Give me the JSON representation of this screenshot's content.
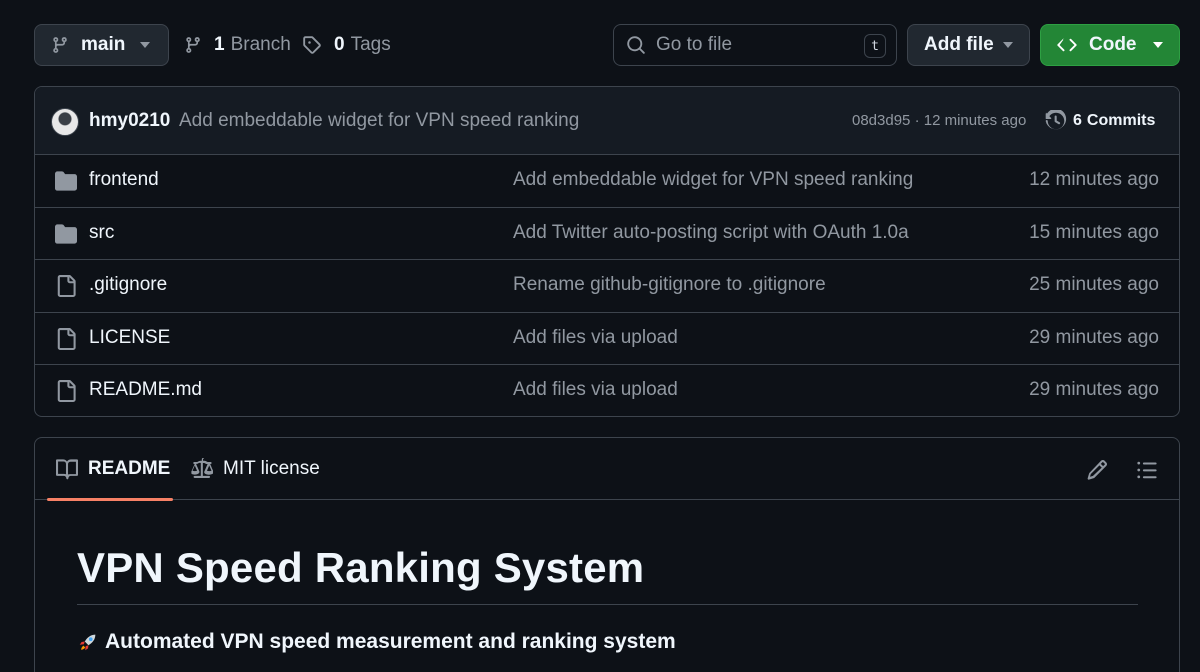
{
  "toolbar": {
    "branch_name": "main",
    "branch_count": "1",
    "branch_label": "Branch",
    "tag_count": "0",
    "tag_label": "Tags",
    "search_placeholder": "Go to file",
    "search_shortcut": "t",
    "add_file_label": "Add file",
    "code_label": "Code"
  },
  "latest_commit": {
    "author": "hmy0210",
    "message": "Add embeddable widget for VPN speed ranking",
    "meta": "08d3d95 · 12 minutes ago",
    "commits_count": "6",
    "commits_label": "Commits"
  },
  "files": [
    {
      "type": "folder",
      "name": "frontend",
      "message": "Add embeddable widget for VPN speed ranking",
      "time": "12 minutes ago"
    },
    {
      "type": "folder",
      "name": "src",
      "message": "Add Twitter auto-posting script with OAuth 1.0a",
      "time": "15 minutes ago"
    },
    {
      "type": "file",
      "name": ".gitignore",
      "message": "Rename github-gitignore to .gitignore",
      "time": "25 minutes ago"
    },
    {
      "type": "file",
      "name": "LICENSE",
      "message": "Add files via upload",
      "time": "29 minutes ago"
    },
    {
      "type": "file",
      "name": "README.md",
      "message": "Add files via upload",
      "time": "29 minutes ago"
    }
  ],
  "readme": {
    "tabs": [
      {
        "label": "README",
        "icon": "book-icon",
        "active": true
      },
      {
        "label": "MIT license",
        "icon": "scale-icon",
        "active": false
      }
    ],
    "title": "VPN Speed Ranking System",
    "subtitle": "Automated VPN speed measurement and ranking system",
    "subtitle_icon": "rocket-icon"
  },
  "colors": {
    "background": "#0d1117",
    "border": "#3d444d",
    "code_button": "#238636",
    "active_tab_underline": "#f78166",
    "muted_text": "#9198a1"
  }
}
